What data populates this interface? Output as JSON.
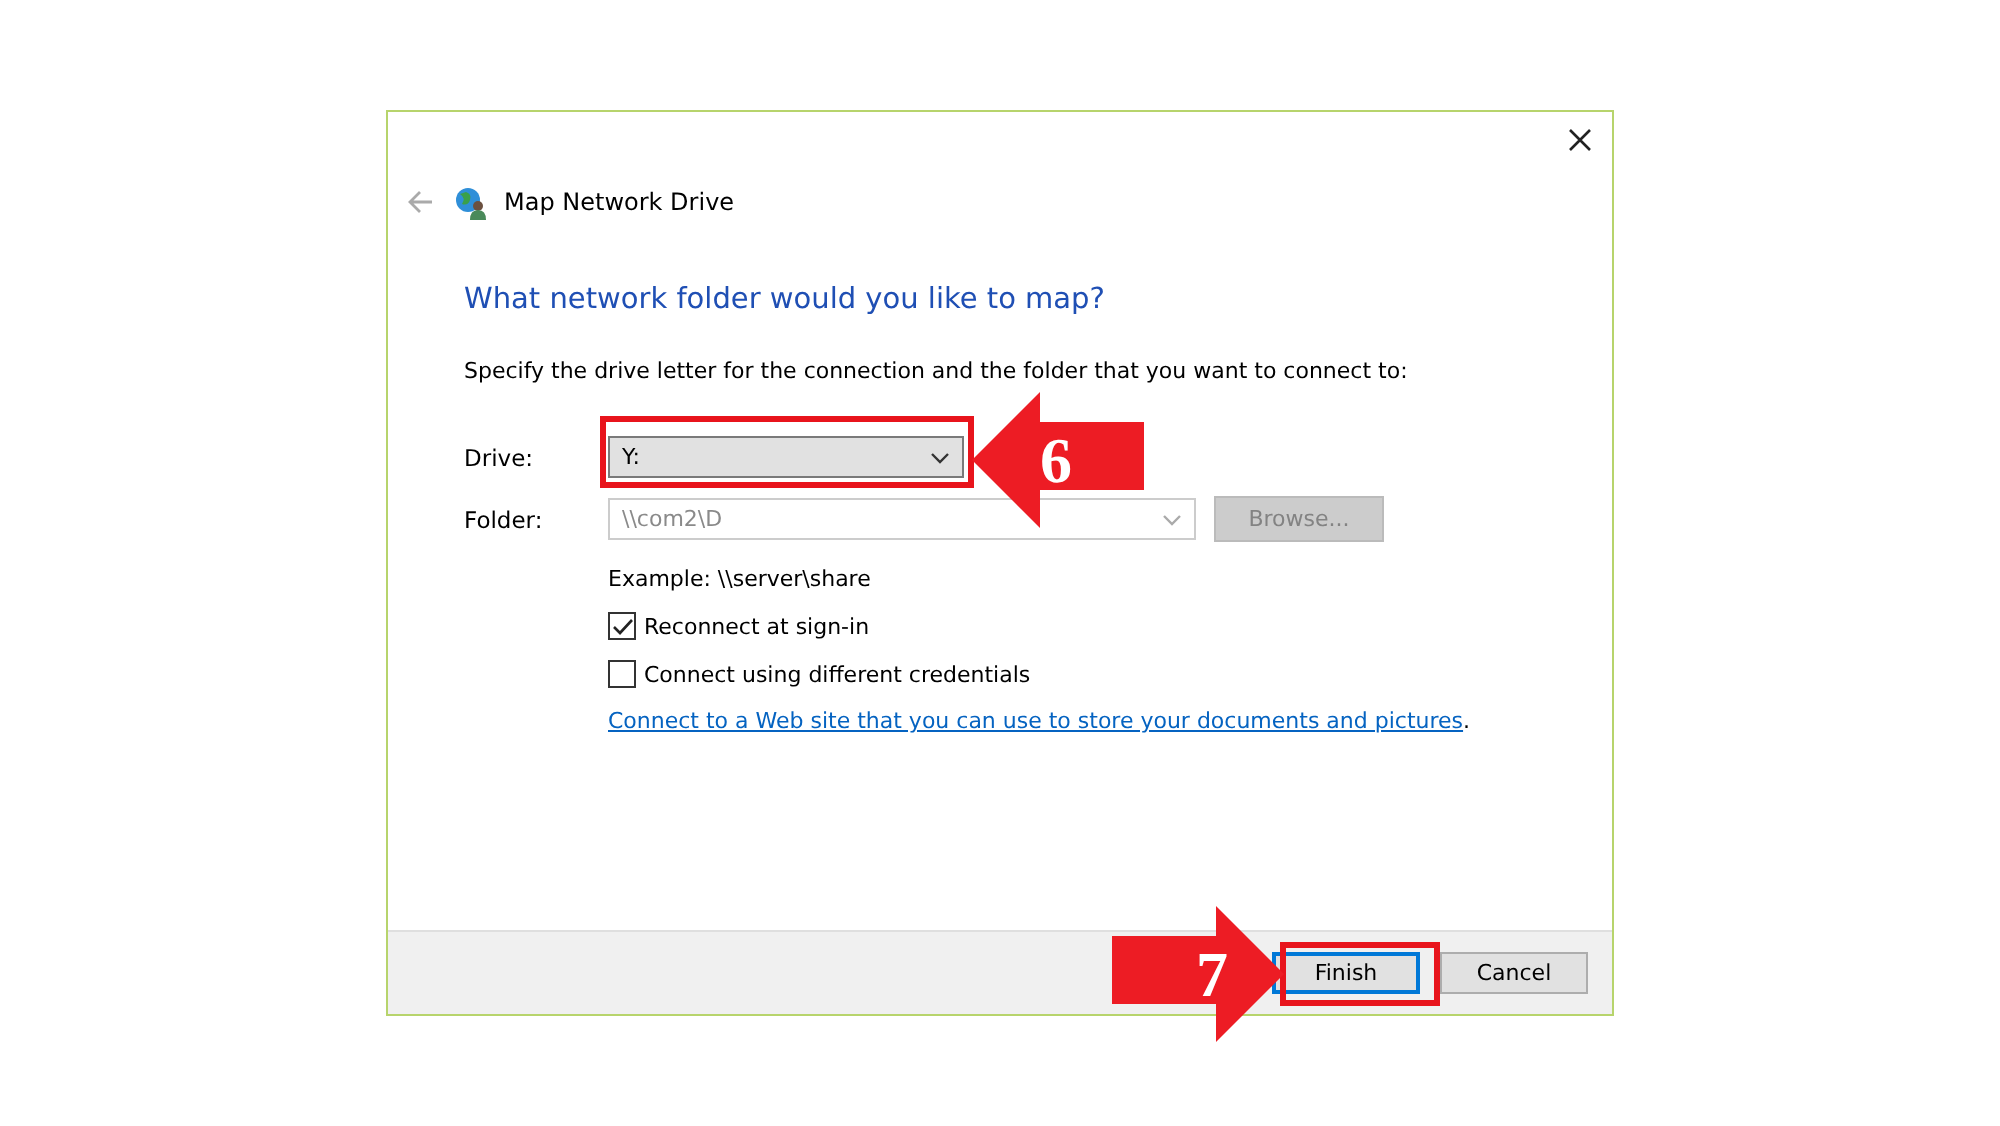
{
  "window": {
    "title": "Map Network Drive",
    "back_disabled": true
  },
  "heading": "What network folder would you like to map?",
  "instructions": "Specify the drive letter for the connection and the folder that you want to connect to:",
  "drive": {
    "label": "Drive:",
    "value": "Y:"
  },
  "folder": {
    "label": "Folder:",
    "value": "\\\\com2\\D",
    "disabled": true
  },
  "browse": {
    "label": "Browse...",
    "disabled": true
  },
  "example": "Example: \\\\server\\share",
  "options": [
    {
      "label": "Reconnect at sign-in",
      "checked": true
    },
    {
      "label": "Connect using different credentials",
      "checked": false
    }
  ],
  "link": {
    "text": "Connect to a Web site that you can use to store your documents and pictures",
    "after": "."
  },
  "buttons": [
    {
      "label": "Finish",
      "default": true
    },
    {
      "label": "Cancel",
      "default": false
    }
  ],
  "callouts": [
    {
      "number": "6",
      "kind": "left"
    },
    {
      "number": "7",
      "kind": "right"
    }
  ]
}
